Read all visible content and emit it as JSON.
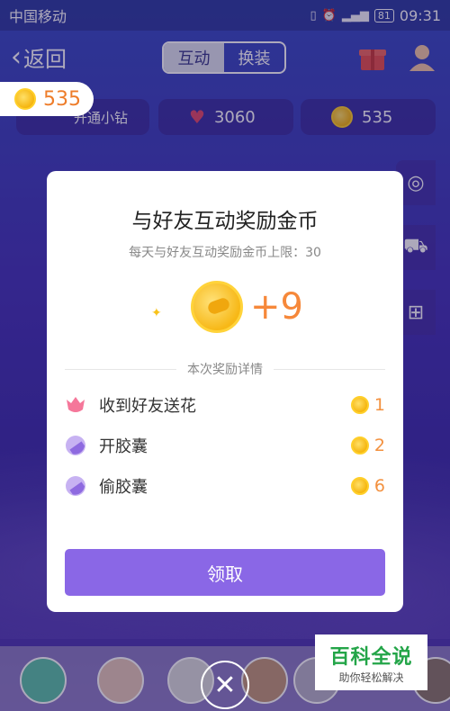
{
  "status_bar": {
    "carrier": "中国移动",
    "battery": "81",
    "time": "09:31"
  },
  "nav": {
    "back_label": "返回",
    "tabs": [
      "互动",
      "换装"
    ],
    "active_tab": "互动"
  },
  "coins_pill": "535",
  "stats": [
    {
      "label": "开通小钻",
      "icon": "diamond-icon"
    },
    {
      "label": "3060",
      "icon": "flower-icon"
    },
    {
      "label": "535",
      "icon": "coin-icon"
    }
  ],
  "modal": {
    "title": "与好友互动奖励金币",
    "subtitle": "每天与好友互动奖励金币上限：30",
    "reward": "+9",
    "section_label": "本次奖励详情",
    "rows": [
      {
        "name": "收到好友送花",
        "icon": "flower-icon",
        "value": "1"
      },
      {
        "name": "开胶囊",
        "icon": "capsule-icon",
        "value": "2"
      },
      {
        "name": "偷胶囊",
        "icon": "capsule-icon",
        "value": "6"
      }
    ],
    "claim_label": "领取"
  },
  "watermark": {
    "title": "百科全说",
    "subtitle": "助你轻松解决"
  },
  "colors": {
    "accent": "#8a67e6",
    "coin": "#f5b50f",
    "reward_text": "#f6883a",
    "background": "#4636b8"
  }
}
